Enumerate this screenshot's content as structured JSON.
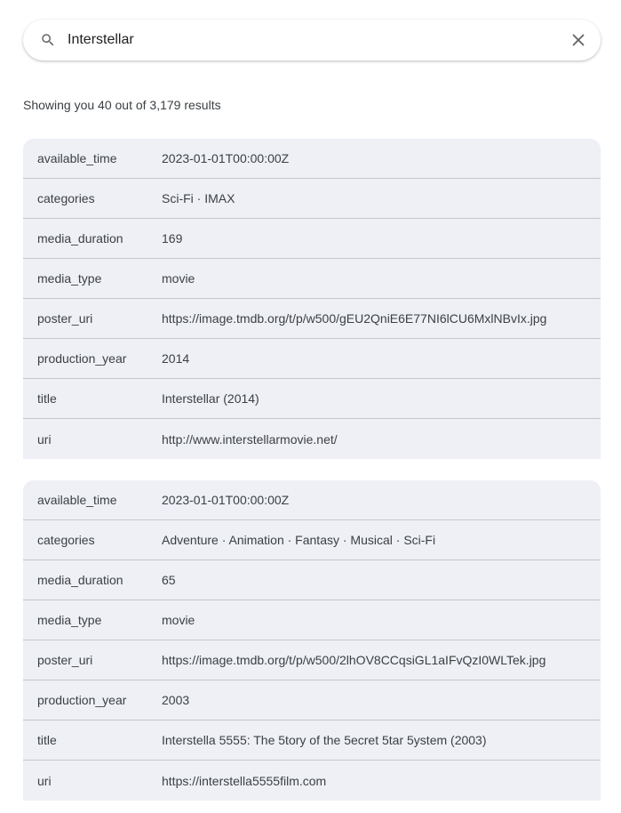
{
  "search": {
    "value": "Interstellar",
    "placeholder": ""
  },
  "results_summary": "Showing you 40 out of 3,179 results",
  "results": [
    {
      "rows": [
        {
          "key": "available_time",
          "value": "2023-01-01T00:00:00Z"
        },
        {
          "key": "categories",
          "value": "Sci-Fi · IMAX"
        },
        {
          "key": "media_duration",
          "value": "169"
        },
        {
          "key": "media_type",
          "value": "movie"
        },
        {
          "key": "poster_uri",
          "value": "https://image.tmdb.org/t/p/w500/gEU2QniE6E77NI6lCU6MxlNBvIx.jpg"
        },
        {
          "key": "production_year",
          "value": "2014"
        },
        {
          "key": "title",
          "value": "Interstellar (2014)"
        },
        {
          "key": "uri",
          "value": "http://www.interstellarmovie.net/"
        }
      ]
    },
    {
      "rows": [
        {
          "key": "available_time",
          "value": "2023-01-01T00:00:00Z"
        },
        {
          "key": "categories",
          "value": "Adventure · Animation · Fantasy · Musical · Sci-Fi"
        },
        {
          "key": "media_duration",
          "value": "65"
        },
        {
          "key": "media_type",
          "value": "movie"
        },
        {
          "key": "poster_uri",
          "value": "https://image.tmdb.org/t/p/w500/2lhOV8CCqsiGL1aIFvQzI0WLTek.jpg"
        },
        {
          "key": "production_year",
          "value": "2003"
        },
        {
          "key": "title",
          "value": "Interstella 5555: The 5tory of the 5ecret 5tar 5ystem (2003)"
        },
        {
          "key": "uri",
          "value": "https://interstella5555film.com"
        }
      ]
    }
  ]
}
